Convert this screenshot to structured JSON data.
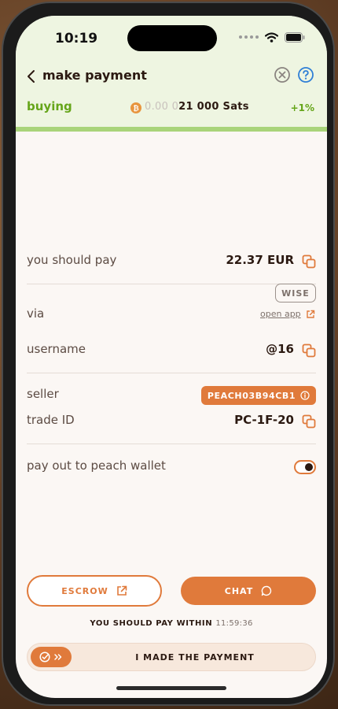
{
  "status_bar": {
    "time": "10:19"
  },
  "header": {
    "title": "make payment"
  },
  "summary": {
    "status": "buying",
    "amount_muted": "0.00 0",
    "amount": "21 000 Sats",
    "premium": "+1%"
  },
  "payment": {
    "pay_label": "you should pay",
    "pay_value": "22.37 EUR",
    "via_label": "via",
    "method": "WISE",
    "open_app": "open app",
    "username_label": "username",
    "username_value": "@16",
    "seller_label": "seller",
    "seller_id": "PEACH03B94CB1",
    "trade_label": "trade ID",
    "trade_id": "PC-1F-20",
    "payout_label": "pay out to peach wallet",
    "payout_enabled": true
  },
  "actions": {
    "escrow": "ESCROW",
    "chat": "CHAT",
    "deadline_label": "YOU SHOULD PAY WITHIN",
    "deadline_time": "11:59:36",
    "confirm": "I MADE THE PAYMENT"
  },
  "colors": {
    "accent": "#e07a3b",
    "success": "#65a519",
    "header_bg": "#eef5e1",
    "text": "#2b1911"
  }
}
